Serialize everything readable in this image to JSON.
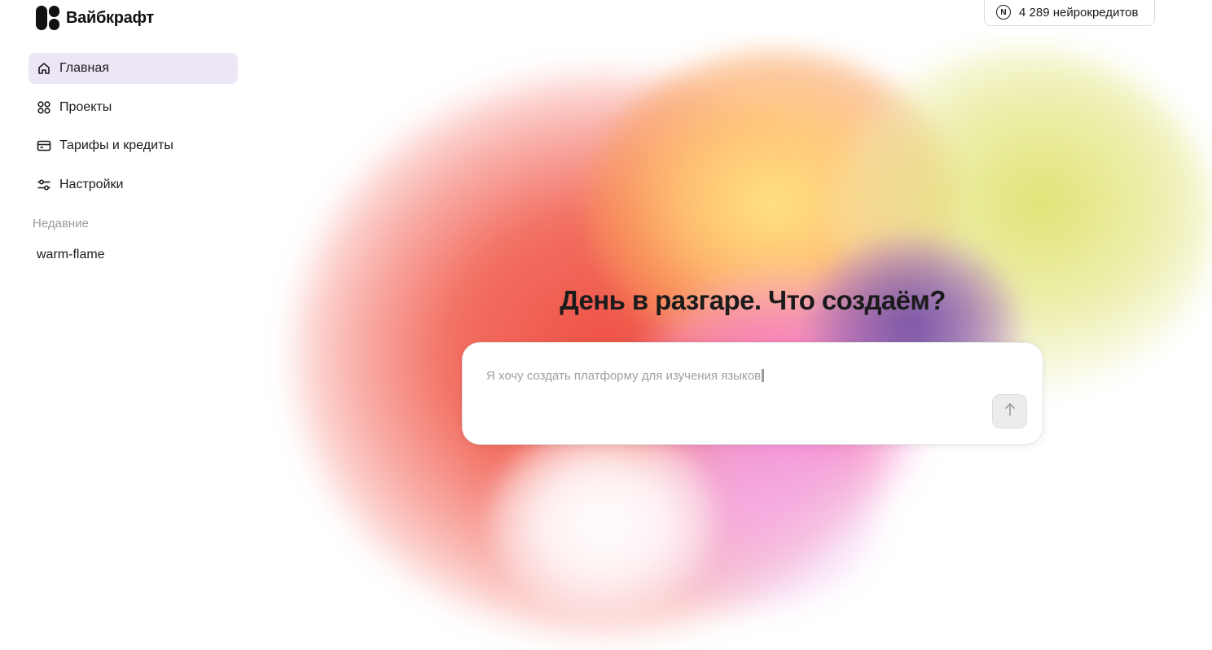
{
  "app": {
    "name": "Вайбкрафт"
  },
  "credits": {
    "label": "4 289 нейрокредитов",
    "icon": "neuro-credits-icon",
    "icon_letter": "N"
  },
  "sidebar": {
    "items": [
      {
        "label": "Главная",
        "icon": "home-icon",
        "active": true
      },
      {
        "label": "Проекты",
        "icon": "projects-grid-icon",
        "active": false
      },
      {
        "label": "Тарифы и кредиты",
        "icon": "credit-card-icon",
        "active": false
      },
      {
        "label": "Настройки",
        "icon": "sliders-icon",
        "active": false
      }
    ],
    "recent_label": "Недавние",
    "recent_items": [
      "warm-flame"
    ]
  },
  "main": {
    "headline": "День в разгаре. Что создаём?",
    "composer_placeholder": "Я хочу создать платформу для изучения языков",
    "send_icon": "arrow-up-icon"
  },
  "colors": {
    "active_nav_bg": "#ede6f6",
    "muted_text": "#9a9a9a",
    "gradient_red": "#ee483a",
    "gradient_yellow": "#dee26e",
    "gradient_purple": "#6e46a0",
    "gradient_pink": "#fa6edc"
  }
}
